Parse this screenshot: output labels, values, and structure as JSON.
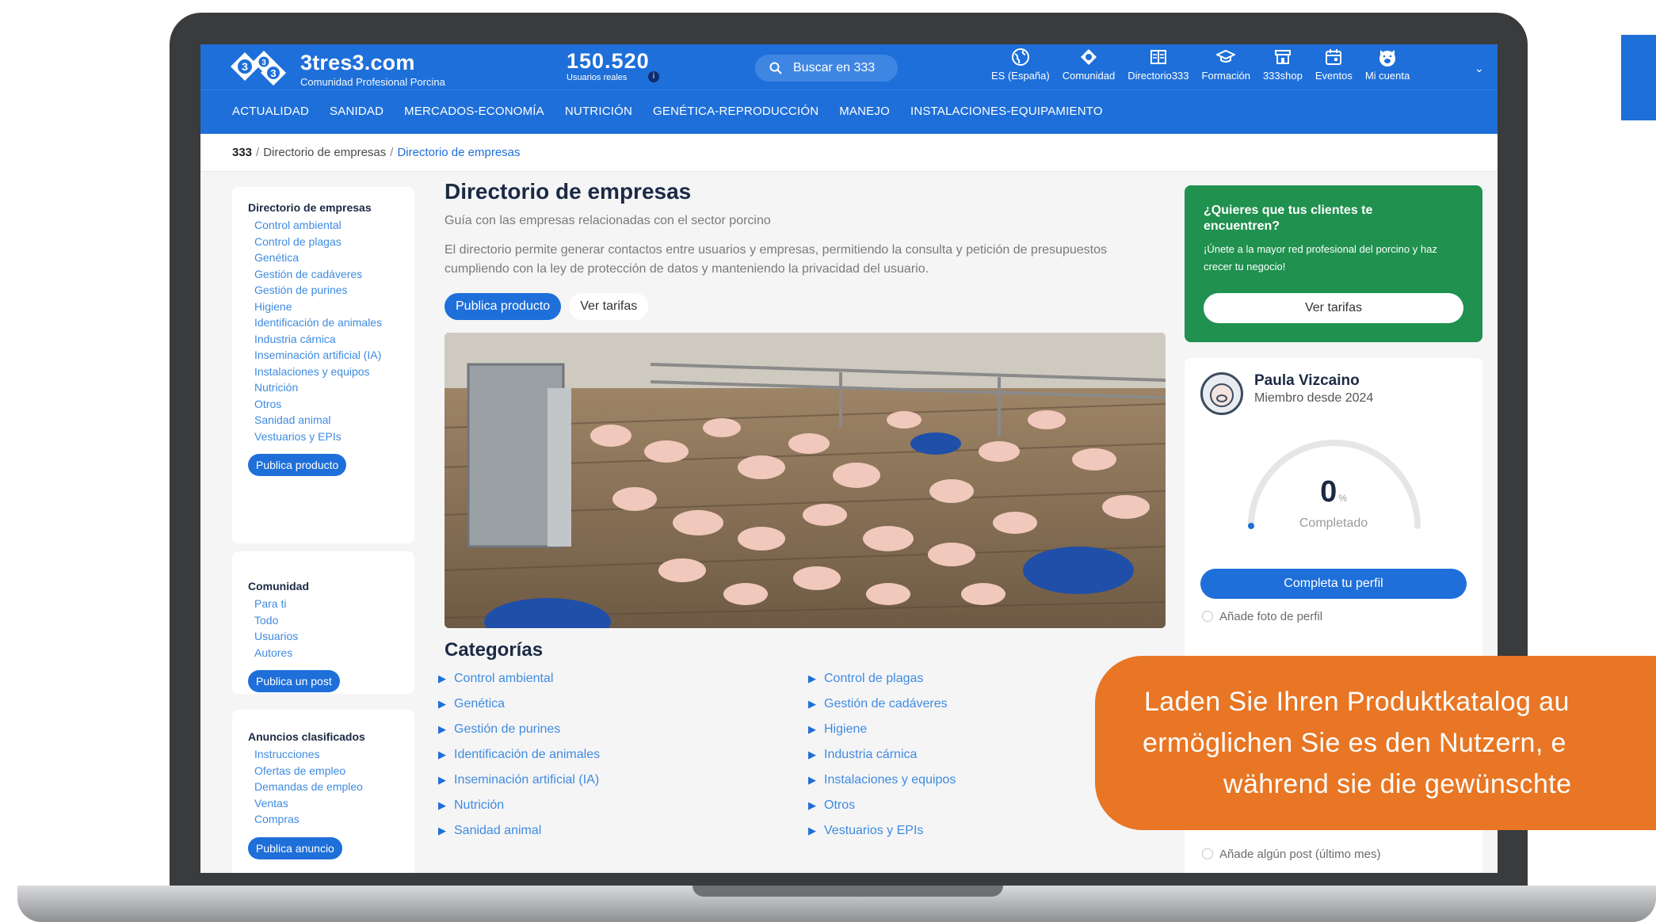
{
  "brand": {
    "logo_digits": [
      "3",
      "3",
      "3"
    ],
    "site_name": "3tres3.com",
    "tagline": "Comunidad Profesional Porcina",
    "users_count": "150.520",
    "users_label": "Usuarios reales",
    "users_info": "i"
  },
  "search": {
    "label": "Buscar en 333"
  },
  "top_nav": [
    {
      "label": "ES (España)",
      "icon": "globe-icon"
    },
    {
      "label": "Comunidad",
      "icon": "community-icon"
    },
    {
      "label": "Directorio333",
      "icon": "directory-icon"
    },
    {
      "label": "Formación",
      "icon": "graduation-icon"
    },
    {
      "label": "333shop",
      "icon": "shop-icon"
    },
    {
      "label": "Eventos",
      "icon": "calendar-icon"
    },
    {
      "label": "Mi cuenta",
      "icon": "pig-avatar-icon"
    }
  ],
  "main_nav": [
    "ACTUALIDAD",
    "SANIDAD",
    "MERCADOS-ECONOMÍA",
    "NUTRICIÓN",
    "GENÉTICA-REPRODUCCIÓN",
    "MANEJO",
    "INSTALACIONES-EQUIPAMIENTO"
  ],
  "breadcrumb": {
    "root": "333",
    "sep": "/",
    "level1": "Directorio de empresas",
    "current": "Directorio de empresas"
  },
  "sidebar": {
    "directory": {
      "title": "Directorio de empresas",
      "items": [
        "Control ambiental",
        "Control de plagas",
        "Genética",
        "Gestión de cadáveres",
        "Gestión de purines",
        "Higiene",
        "Identificación de animales",
        "Industria cárnica",
        "Inseminación artificial (IA)",
        "Instalaciones y equipos",
        "Nutrición",
        "Otros",
        "Sanidad animal",
        "Vestuarios y EPIs"
      ],
      "button": "Publica producto"
    },
    "community": {
      "title": "Comunidad",
      "items": [
        "Para ti",
        "Todo",
        "Usuarios",
        "Autores"
      ],
      "button": "Publica un post"
    },
    "classifieds": {
      "title": "Anuncios clasificados",
      "items": [
        "Instrucciones",
        "Ofertas de empleo",
        "Demandas de empleo",
        "Ventas",
        "Compras"
      ],
      "button": "Publica anuncio"
    }
  },
  "main": {
    "title": "Directorio de empresas",
    "subtitle": "Guía con las empresas relacionadas con el sector porcino",
    "description": "El directorio permite generar contactos entre usuarios y empresas, permitiendo la consulta y petición de presupuestos cumpliendo con la ley de protección de datos y manteniendo la privacidad del usuario.",
    "btn_publish": "Publica producto",
    "btn_rates": "Ver tarifas",
    "categories_title": "Categorías",
    "categories_left": [
      "Control ambiental",
      "Genética",
      "Gestión de purines",
      "Identificación de animales",
      "Inseminación artificial (IA)",
      "Nutrición",
      "Sanidad animal"
    ],
    "categories_right": [
      "Control de plagas",
      "Gestión de cadáveres",
      "Higiene",
      "Industria cárnica",
      "Instalaciones y equipos",
      "Otros",
      "Vestuarios y EPIs"
    ]
  },
  "promo": {
    "title": "¿Quieres que tus clientes te encuentren?",
    "text": "¡Únete a la mayor red profesional del porcino y haz crecer tu negocio!",
    "button": "Ver tarifas"
  },
  "profile": {
    "name": "Paula Vizcaino",
    "member_since": "Miembro desde 2024",
    "completion_value": "0",
    "completion_unit": "%",
    "completion_fraction": 0,
    "completion_label": "Completado",
    "button": "Completa tu perfil",
    "checklist": [
      "Añade foto de perfil",
      "Añade algún post (último mes)"
    ]
  },
  "callout": {
    "line1": "Laden Sie Ihren Produktkatalog au",
    "line2": "ermöglichen Sie es den Nutzern, e",
    "line3": "während sie die gewünschte"
  },
  "colors": {
    "primary": "#1e6fd9",
    "promo_green": "#20914f",
    "callout_orange": "#e87624",
    "link": "#3f8be0"
  }
}
